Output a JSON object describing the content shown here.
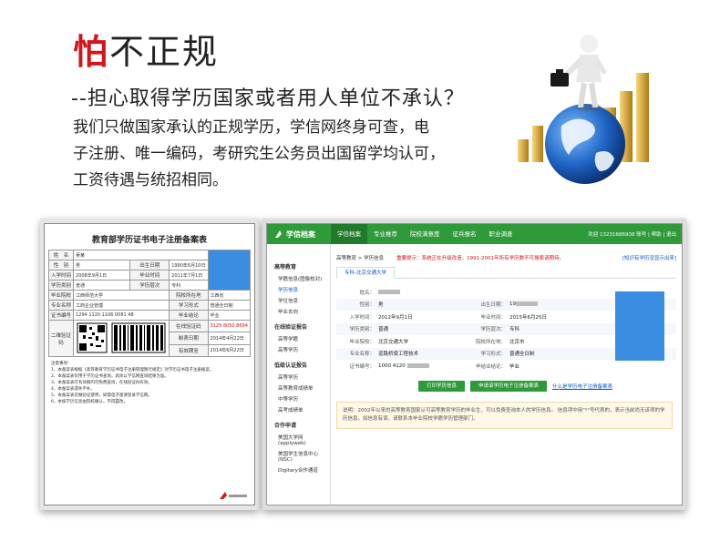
{
  "header": {
    "title_red": "怕",
    "title_rest": "不正规",
    "subtitle": "--担心取得学历国家或者用人单位不承认？",
    "body_lines": [
      "我们只做国家承认的正规学历，学信网终身可查，电",
      "子注册、唯一编码，考研究生公务员出国留学均认可，",
      "工资待遇与统招相同。"
    ]
  },
  "certificate": {
    "title": "教育部学历证书电子注册备案表",
    "rows": [
      {
        "label": "姓　名",
        "value": "吴某"
      },
      {
        "label": "性　别",
        "value": "男",
        "label2": "出生日期",
        "value2": "1990年6月10日"
      },
      {
        "label": "入学时间",
        "value": "2008年9月1日",
        "label2": "毕业时间",
        "value2": "2011年7月1日"
      },
      {
        "label": "学历类别",
        "value": "普通",
        "label2": "学历层次",
        "value2": "专科"
      },
      {
        "label": "毕业院校",
        "value": "江西师范大学",
        "label2": "院校所在地",
        "value2": "江西省"
      },
      {
        "label": "专业名称",
        "value": "工商企业管理",
        "label2": "学习形式",
        "value2": "普通全日制"
      },
      {
        "label": "证书编号",
        "value": "1294 1120 1106 0081 48",
        "label2": "毕业结论",
        "value2": "毕业"
      }
    ],
    "verify_label": "二维验证码",
    "verify_rows": [
      {
        "label": "在线验证码",
        "value": "3129 8050 8694"
      },
      {
        "label": "制表日期",
        "value": "2014年4月22日"
      },
      {
        "label": "有效期至",
        "value": "2014年6月22日"
      }
    ],
    "notes_title": "注意事项：",
    "notes": [
      "1、本备案表根据《高等教育学历证书电子注册管理暂行规定》对学历证书电子注册备案，",
      "2、本备案表仅用于学历证书查询，具体以学信网查询结果为准。",
      "3、本备案表在有效期内可免费查询，在线验证码有效。",
      "4、本备案表遗失不补。",
      "5、本备案表仅做验证使用，如需电子版请登录学信网。",
      "6、本核学历信息由院校确认，不得篡改。"
    ]
  },
  "browser": {
    "logo": "学信档案",
    "nav": [
      "学信档案",
      "专业推荐",
      "院校满意度",
      "征兵报名",
      "职业调查"
    ],
    "top_right": "欢迎 13231686938 账号 | 帮助 | 退出",
    "sidebar": [
      {
        "section": "高等教育",
        "items": [
          "学籍信息(图像校对)",
          "学历信息",
          "学位信息",
          "毕业去向"
        ]
      },
      {
        "section": "在线验证报告",
        "items": [
          "高等学籍",
          "高等学历"
        ]
      },
      {
        "section": "低级认证报告",
        "items": [
          "高等学历",
          "高等教育成绩单",
          "中等学历",
          "高考成绩单"
        ]
      },
      {
        "section": "合作申请",
        "items": [
          "美国大学网 (applyweb)",
          "美国学生信息中心 (NSC)",
          "Digitary合作通道"
        ]
      }
    ],
    "breadcrumb": "高等教育 > 学历信息",
    "notice": "重要提示：系统正在升级改造，1991-2001年所有学历数不可搜索请期待。",
    "notice_link": "[知识有学历没显示出来]",
    "tab": "专科-北京交通大学",
    "fields": [
      {
        "label": "姓名：",
        "value": "",
        "label2": "",
        "value2": ""
      },
      {
        "label": "性别：",
        "value": "男",
        "label2": "出生日期：",
        "value2": "19"
      },
      {
        "label": "入学时间：",
        "value": "2012年9月1日",
        "label2": "毕业时间：",
        "value2": "2015年6月25日"
      },
      {
        "label": "学历类别：",
        "value": "普通",
        "label2": "学历层次：",
        "value2": "专科"
      },
      {
        "label": "毕业院校：",
        "value": "北京交通大学",
        "label2": "院校所在地：",
        "value2": "北京市"
      },
      {
        "label": "专业名称：",
        "value": "道路桥梁工程技术",
        "label2": "学习形式：",
        "value2": "普通全日制"
      },
      {
        "label": "证书编号：",
        "value": "1000 4120",
        "label2": "毕结业结论：",
        "value2": "毕业"
      }
    ],
    "btn_print": "打印学历信息",
    "btn_apply": "申请该学历电子注册备案表",
    "link_what": "什么是学历电子注册备案表",
    "note": "说明：2002年以来的高等教育国家认可高等教育学历的毕业生，可以免费查询本人的学历信息。 信息项中用\"*\"号代表的，表示当前尚无该项的学历信息。如信息有误，请联系本毕业院校学籍学历管理部门。"
  },
  "colors": {
    "accent_red": "#d4141b",
    "browser_green": "#2e9a3a",
    "photo_blue": "#3b8de2",
    "link_blue": "#0a58c8"
  }
}
